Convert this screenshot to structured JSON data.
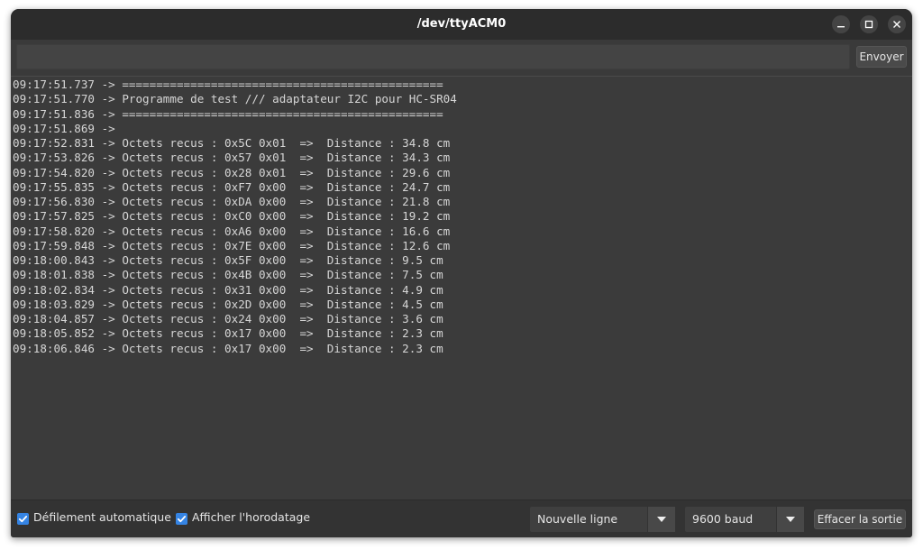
{
  "window": {
    "title": "/dev/ttyACM0"
  },
  "send": {
    "input_value": "",
    "button_label": "Envoyer"
  },
  "output": {
    "lines": [
      "09:17:51.737 -> ===============================================",
      "09:17:51.770 -> Programme de test /// adaptateur I2C pour HC-SR04",
      "09:17:51.836 -> ===============================================",
      "09:17:51.869 ->",
      "09:17:52.831 -> Octets recus : 0x5C 0x01  =>  Distance : 34.8 cm",
      "09:17:53.826 -> Octets recus : 0x57 0x01  =>  Distance : 34.3 cm",
      "09:17:54.820 -> Octets recus : 0x28 0x01  =>  Distance : 29.6 cm",
      "09:17:55.835 -> Octets recus : 0xF7 0x00  =>  Distance : 24.7 cm",
      "09:17:56.830 -> Octets recus : 0xDA 0x00  =>  Distance : 21.8 cm",
      "09:17:57.825 -> Octets recus : 0xC0 0x00  =>  Distance : 19.2 cm",
      "09:17:58.820 -> Octets recus : 0xA6 0x00  =>  Distance : 16.6 cm",
      "09:17:59.848 -> Octets recus : 0x7E 0x00  =>  Distance : 12.6 cm",
      "09:18:00.843 -> Octets recus : 0x5F 0x00  =>  Distance : 9.5 cm",
      "09:18:01.838 -> Octets recus : 0x4B 0x00  =>  Distance : 7.5 cm",
      "09:18:02.834 -> Octets recus : 0x31 0x00  =>  Distance : 4.9 cm",
      "09:18:03.829 -> Octets recus : 0x2D 0x00  =>  Distance : 4.5 cm",
      "09:18:04.857 -> Octets recus : 0x24 0x00  =>  Distance : 3.6 cm",
      "09:18:05.852 -> Octets recus : 0x17 0x00  =>  Distance : 2.3 cm",
      "09:18:06.846 -> Octets recus : 0x17 0x00  =>  Distance : 2.3 cm"
    ]
  },
  "footer": {
    "autoscroll_label": "Défilement automatique",
    "autoscroll_checked": true,
    "timestamp_label": "Afficher l'horodatage",
    "timestamp_checked": true,
    "line_ending_value": "Nouvelle ligne",
    "baud_value": "9600 baud",
    "clear_label": "Effacer la sortie"
  },
  "icons": {
    "minimize": "minimize-icon",
    "maximize": "maximize-icon",
    "close": "close-icon",
    "checkbox": "checkmark-icon",
    "dropdown": "chevron-down-icon"
  },
  "colors": {
    "accent": "#3584e4",
    "titlebar": "#2c2c2c",
    "console_bg": "#3b3b3b",
    "console_text": "#d6d6d6"
  }
}
